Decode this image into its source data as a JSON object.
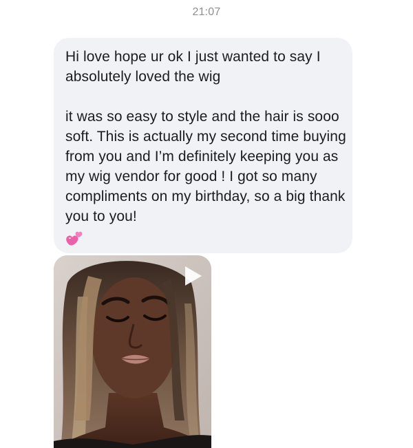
{
  "header": {
    "time": "21:07"
  },
  "message": {
    "paragraph1": "Hi love hope ur ok I just wanted to say I absolutely loved the wig",
    "paragraph2": "it was so easy to style and the hair is sooo soft. This is actually my second time buying from you and I’m definitely keeping you as my wig vendor for good ! I got so many compliments on my birthday, so a big thank you to you!",
    "emoji": "two-hearts-emoji",
    "bubble_color": "#f1f2f5"
  },
  "attachment": {
    "type": "video",
    "icon": "play-icon"
  }
}
